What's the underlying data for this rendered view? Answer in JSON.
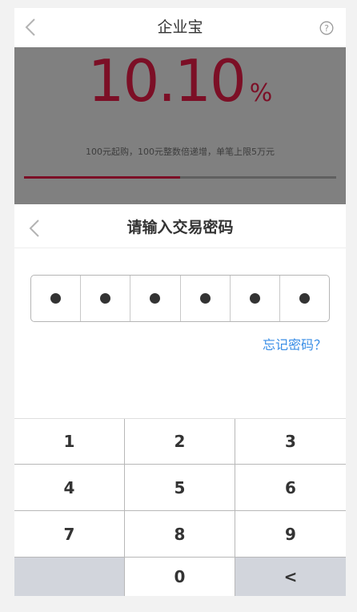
{
  "header": {
    "title": "企业宝",
    "back_icon": "chevron-left-icon",
    "help_icon": "question-circle-icon"
  },
  "product": {
    "rate_value": "10.10",
    "rate_unit": "%",
    "description": "100元起购，100元整数倍递增，单笔上限5万元",
    "progress_fraction": 0.5,
    "accent_color": "#7c0f26"
  },
  "password_modal": {
    "title": "请输入交易密码",
    "back_icon": "chevron-left-icon",
    "digits_entered": 6,
    "digit_count": 6,
    "forgot_link": "忘记密码？",
    "link_color": "#3a8ee6"
  },
  "keypad": {
    "keys": [
      "1",
      "2",
      "3",
      "4",
      "5",
      "6",
      "7",
      "8",
      "9",
      "",
      "0",
      "<"
    ]
  }
}
